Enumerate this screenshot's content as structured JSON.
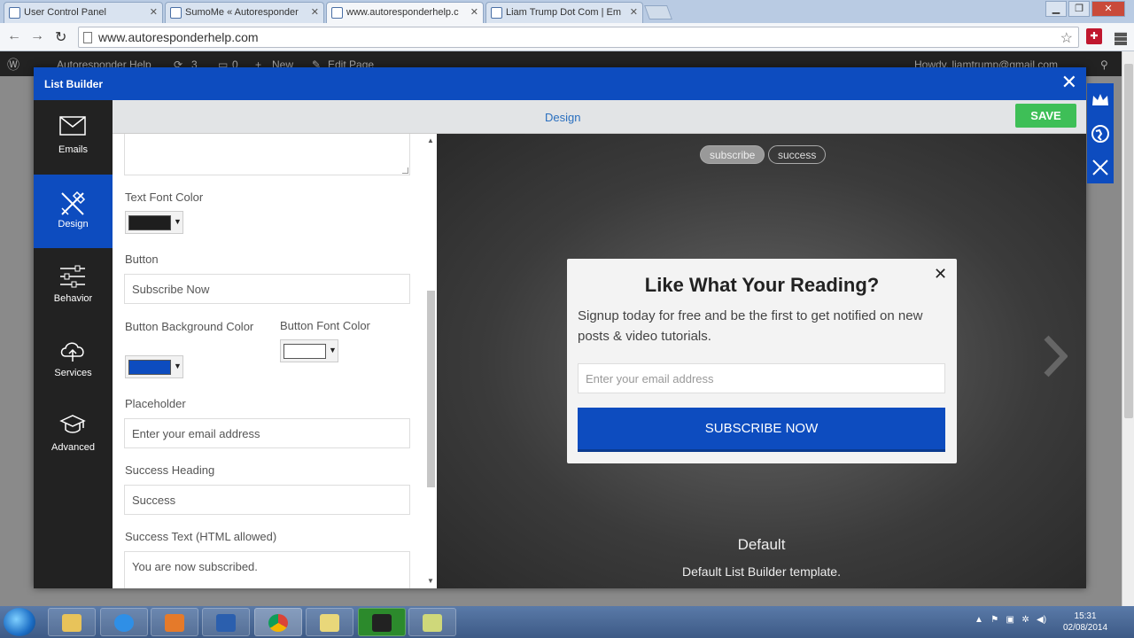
{
  "browser": {
    "tabs": [
      {
        "label": "User Control Panel"
      },
      {
        "label": "SumoMe « Autoresponder"
      },
      {
        "label": "www.autoresponderhelp.c"
      },
      {
        "label": "Liam Trump Dot Com | Em"
      }
    ],
    "url": "www.autoresponderhelp.com"
  },
  "wpbar": {
    "site": "Autoresponder Help",
    "updates": "3",
    "comments": "0",
    "new": "New",
    "edit": "Edit Page",
    "howdy": "Howdy, liamtrump@gmail.com"
  },
  "modal": {
    "title": "List Builder",
    "tab_title": "Design",
    "save_label": "SAVE"
  },
  "sidebar": {
    "items": [
      {
        "label": "Emails",
        "icon": "envelope-icon"
      },
      {
        "label": "Design",
        "icon": "design-tools-icon"
      },
      {
        "label": "Behavior",
        "icon": "sliders-icon"
      },
      {
        "label": "Services",
        "icon": "cloud-upload-icon"
      },
      {
        "label": "Advanced",
        "icon": "graduation-cap-icon"
      }
    ]
  },
  "form": {
    "text_font_color_label": "Text Font Color",
    "text_font_color": "#1e1e1e",
    "button_label": "Button",
    "button_value": "Subscribe Now",
    "button_bg_label": "Button Background Color",
    "button_bg_color": "#0d4cbf",
    "button_font_label": "Button Font Color",
    "button_font_color": "#ffffff",
    "placeholder_label": "Placeholder",
    "placeholder_value": "Enter your email address",
    "success_heading_label": "Success Heading",
    "success_heading_value": "Success",
    "success_text_label": "Success Text (HTML allowed)",
    "success_text_value": "You are now subscribed."
  },
  "preview": {
    "pills": [
      "subscribe",
      "success"
    ],
    "popup_heading": "Like What Your Reading?",
    "popup_text": "Signup today for free and be the first to get notified on new posts & video tutorials.",
    "popup_input_placeholder": "Enter your email address",
    "popup_button": "SUBSCRIBE NOW",
    "template_name": "Default",
    "template_desc": "Default List Builder template."
  },
  "taskbar": {
    "time": "15:31",
    "date": "02/08/2014"
  },
  "colors": {
    "brand_blue": "#0d4cbf",
    "save_green": "#3ebf57"
  }
}
